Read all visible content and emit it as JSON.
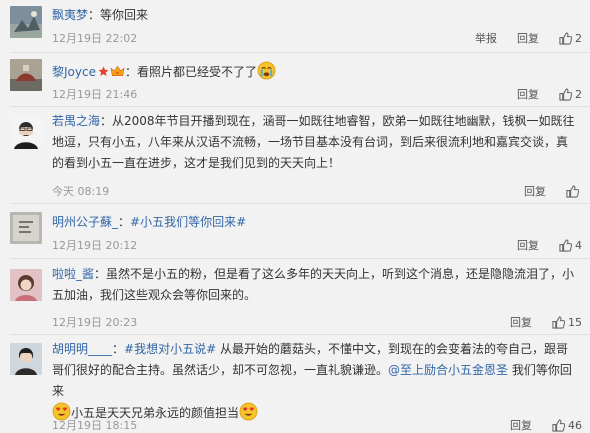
{
  "comments": [
    {
      "username": "飘夷梦",
      "text": "：等你回来",
      "time": "12月19日 22:02",
      "report_label": "举报",
      "reply_label": "回复",
      "likes": "2"
    },
    {
      "username": "黎Joyce",
      "text": "：看照片都已经受不了了",
      "time": "12月19日 21:46",
      "reply_label": "回复",
      "likes": "2"
    },
    {
      "username": "若禺之海",
      "text": "：从2008年节目开播到现在，涵哥一如既往地睿智，欧弟一如既往地幽默，钱枫一如既往地逗，只有小五，八年来从汉语不流畅，一场节目基本没有台词，到后来很流利地和嘉宾交谈，真的看到小五一直在进步，这才是我们见到的天天向上！",
      "time": "今天 08:19",
      "reply_label": "回复",
      "likes": ""
    },
    {
      "username": "明州公子蘇_",
      "text_sep": "：",
      "topic": "#小五我们等你回来#",
      "time": "12月19日 20:12",
      "reply_label": "回复",
      "likes": "4"
    },
    {
      "username": "啦啦_酱",
      "text": "：虽然不是小五的粉，但是看了这么多年的天天向上，听到这个消息，还是隐隐流泪了，小五加油，我们这些观众会等你回来的。",
      "time": "12月19日 20:23",
      "reply_label": "回复",
      "likes": "15"
    },
    {
      "username": "胡明明____",
      "text_sep": "：",
      "topic": "#我想对小五说#",
      "text": " 从最开始的蘑菇头，不懂中文，到现在的会变着法的夸自己，跟哥哥们很好的配合主持。虽然话少，却不可忽视，一直礼貌谦逊。",
      "mention": "@至上励合小五金恩圣",
      "text2": " 我们等你回来",
      "text3": "小五是天天兄弟永远的颜值担当",
      "time": "12月19日 18:15",
      "reply_label": "回复",
      "likes": "46"
    }
  ],
  "icons": {
    "like": "thumbs-up-icon",
    "vip": "star-icon",
    "crown": "crown-icon",
    "crying": "crying-emoji-icon",
    "heart_eyes": "heart-eyes-emoji-icon"
  },
  "colors": {
    "link": "#3366a6",
    "time": "#999999",
    "background": "#f2f2f2",
    "vip_star": "#e8402b"
  }
}
